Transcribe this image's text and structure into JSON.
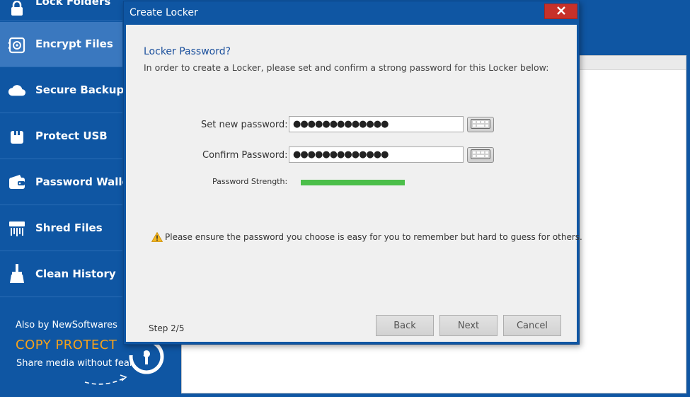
{
  "sidebar": {
    "items": [
      {
        "label": "Lock Folders",
        "icon": "lock-icon"
      },
      {
        "label": "Encrypt Files",
        "icon": "safe-icon"
      },
      {
        "label": "Secure Backup",
        "icon": "cloud-icon"
      },
      {
        "label": "Protect USB",
        "icon": "usb-icon"
      },
      {
        "label": "Password Wallet",
        "icon": "wallet-icon"
      },
      {
        "label": "Shred Files",
        "icon": "shredder-icon"
      },
      {
        "label": "Clean History",
        "icon": "broom-icon"
      }
    ],
    "active_index": 1
  },
  "promo": {
    "by_text": "Also by NewSoftwares",
    "title": "COPY PROTECT",
    "subtitle": "Share media without fear",
    "logo_icon": "copy-protect-logo-icon"
  },
  "dialog": {
    "title": "Create Locker",
    "close_icon": "close-icon",
    "heading": "Locker Password?",
    "instructions": "In order to create a Locker, please set and confirm a strong password for this Locker below:",
    "fields": {
      "new_password_label": "Set new password:",
      "new_password_value": "●●●●●●●●●●●●●",
      "confirm_password_label": "Confirm Password:",
      "confirm_password_value": "●●●●●●●●●●●●●",
      "keyboard_icon": "keyboard-icon"
    },
    "strength": {
      "label": "Password Strength:",
      "level": 1.0,
      "color": "#4cbf4a"
    },
    "warning": {
      "icon": "warning-icon",
      "text": "Please ensure the password you choose is easy for you to remember but hard to guess for others."
    },
    "step": "Step 2/5",
    "buttons": {
      "back": "Back",
      "next": "Next",
      "cancel": "Cancel"
    }
  },
  "colors": {
    "brand_blue": "#0f56a3",
    "accent_orange": "#f6a21a",
    "close_red": "#c7312a"
  }
}
